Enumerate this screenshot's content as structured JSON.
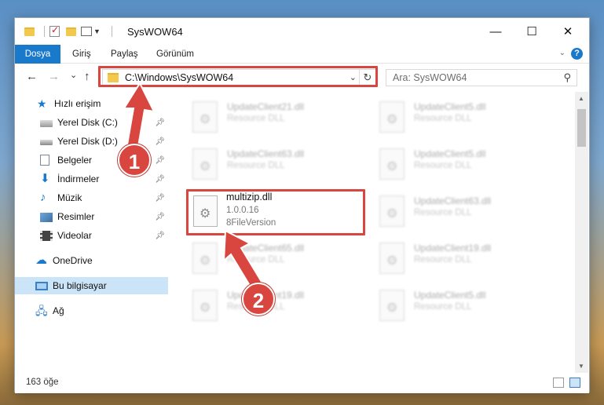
{
  "window": {
    "title": "SysWOW64",
    "controls": {
      "minimize": "—",
      "maximize": "☐",
      "close": "✕"
    }
  },
  "ribbon": {
    "tabs": [
      "Dosya",
      "Giriş",
      "Paylaş",
      "Görünüm"
    ],
    "help": "?"
  },
  "nav": {
    "back": "←",
    "forward": "→",
    "recent": "⌄",
    "up": "↑",
    "address": "C:\\Windows\\SysWOW64",
    "search_placeholder": "Ara: SysWOW64"
  },
  "sidebar": {
    "quick_access": "Hızlı erişim",
    "pinned": [
      {
        "label": "Yerel Disk (C:)",
        "icon": "drive-icon"
      },
      {
        "label": "Yerel Disk (D:)",
        "icon": "drive-icon"
      },
      {
        "label": "Belgeler",
        "icon": "documents-icon"
      },
      {
        "label": "İndirmeler",
        "icon": "downloads-icon"
      },
      {
        "label": "Müzik",
        "icon": "music-icon"
      },
      {
        "label": "Resimler",
        "icon": "pictures-icon"
      },
      {
        "label": "Videolar",
        "icon": "videos-icon"
      }
    ],
    "onedrive": "OneDrive",
    "this_pc": "Bu bilgisayar",
    "network": "Ağ"
  },
  "files": {
    "selected": {
      "name": "multizip.dll",
      "version": "1.0.0.16",
      "description": "8FileVersion"
    },
    "left_column": [
      {
        "name": "UpdateClient21.dll",
        "desc": "Resource DLL"
      },
      {
        "name": "UpdateClient63.dll",
        "desc": "Resource DLL"
      },
      {
        "name": "UpdateClient65.dll",
        "desc": "Resource DLL"
      },
      {
        "name": "UpdateClient19.dll",
        "desc": "Resource DLL"
      }
    ],
    "right_column": [
      {
        "name": "UpdateClient5.dll",
        "desc": "Resource DLL"
      },
      {
        "name": "UpdateClient5.dll",
        "desc": "Resource DLL"
      },
      {
        "name": "UpdateClient63.dll",
        "desc": "Resource DLL"
      },
      {
        "name": "UpdateClient19.dll",
        "desc": "Resource DLL"
      },
      {
        "name": "UpdateClient5.dll",
        "desc": "Resource DLL"
      }
    ]
  },
  "status": {
    "count": "163 öğe"
  },
  "callouts": [
    "1",
    "2"
  ],
  "colors": {
    "accent": "#1979ca",
    "highlight": "#d9453f",
    "selection": "#cce4f7"
  }
}
